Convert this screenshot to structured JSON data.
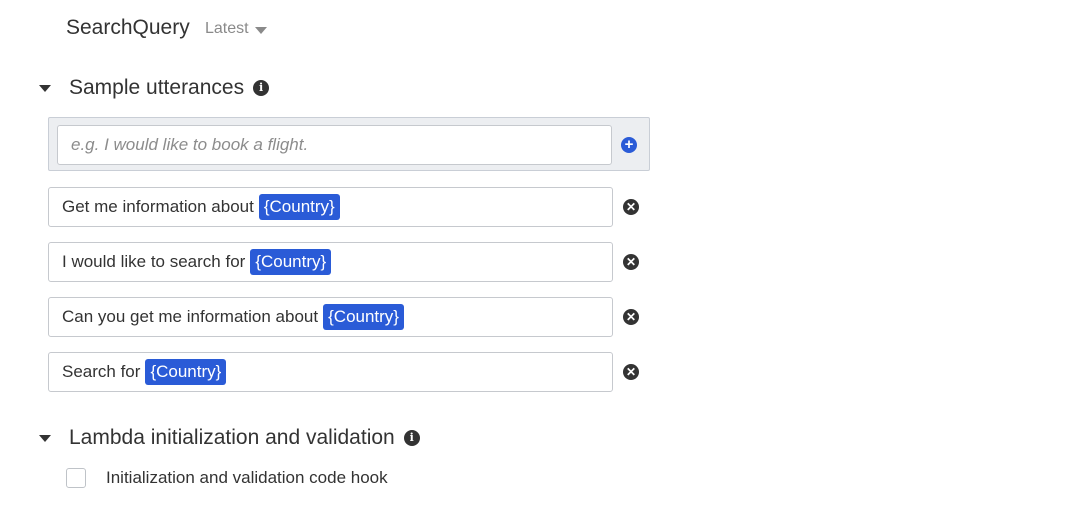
{
  "intent": {
    "name": "SearchQuery",
    "version": "Latest"
  },
  "sample_utterances": {
    "title": "Sample utterances",
    "new_placeholder": "e.g. I would like to book a flight.",
    "items": [
      {
        "text": "Get me information about",
        "slot": "{Country}"
      },
      {
        "text": "I would like to search for",
        "slot": "{Country}"
      },
      {
        "text": "Can you get me information about",
        "slot": "{Country}"
      },
      {
        "text": "Search for",
        "slot": "{Country}"
      }
    ]
  },
  "lambda": {
    "title": "Lambda initialization and validation",
    "checkbox_label": "Initialization and validation code hook",
    "checked": false
  },
  "icons": {
    "info": "info-icon",
    "add": "plus-circle-icon",
    "remove": "x-circle-icon",
    "caret": "caret-down-icon"
  },
  "colors": {
    "accent": "#2a5bd7",
    "text": "#333333"
  }
}
